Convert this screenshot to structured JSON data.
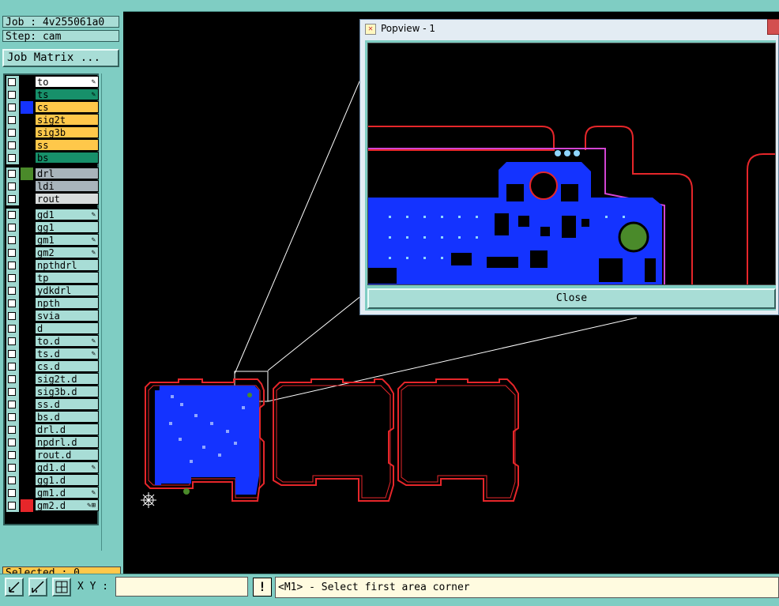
{
  "job": {
    "job_label": "Job : 4v255061a0",
    "step_label": "Step: cam",
    "matrix_button": "Job Matrix ..."
  },
  "layers": [
    {
      "name": "to",
      "bg": "#ffffff",
      "color": "#000000",
      "flag": "✎"
    },
    {
      "name": "ts",
      "bg": "#17906a",
      "color": "#000000",
      "flag": "✎"
    },
    {
      "name": "cs",
      "bg": "#ffc84a",
      "color": "#1433ff",
      "flag": ""
    },
    {
      "name": "sig2t",
      "bg": "#ffc84a",
      "color": "#000000",
      "flag": ""
    },
    {
      "name": "sig3b",
      "bg": "#ffc84a",
      "color": "#000000",
      "flag": ""
    },
    {
      "name": "ss",
      "bg": "#ffc84a",
      "color": "#000000",
      "flag": ""
    },
    {
      "name": "bs",
      "bg": "#17906a",
      "color": "#000000",
      "flag": ""
    },
    {
      "name": "drl",
      "bg": "#a8b4bb",
      "color": "#4a8a2a",
      "flag": ""
    },
    {
      "name": "ldi",
      "bg": "#a8b4bb",
      "color": "#000000",
      "flag": ""
    },
    {
      "name": "rout",
      "bg": "#d8dcdc",
      "color": "#000000",
      "flag": ""
    },
    {
      "name": "gd1",
      "bg": "#a8ddd6",
      "color": "#000000",
      "flag": "✎"
    },
    {
      "name": "gg1",
      "bg": "#a8ddd6",
      "color": "#000000",
      "flag": ""
    },
    {
      "name": "gm1",
      "bg": "#a8ddd6",
      "color": "#000000",
      "flag": "✎"
    },
    {
      "name": "gm2",
      "bg": "#a8ddd6",
      "color": "#000000",
      "flag": "✎"
    },
    {
      "name": "npthdrl",
      "bg": "#a8ddd6",
      "color": "#000000",
      "flag": ""
    },
    {
      "name": "tp",
      "bg": "#a8ddd6",
      "color": "#000000",
      "flag": ""
    },
    {
      "name": "ydkdrl",
      "bg": "#a8ddd6",
      "color": "#000000",
      "flag": ""
    },
    {
      "name": "npth",
      "bg": "#a8ddd6",
      "color": "#000000",
      "flag": ""
    },
    {
      "name": "svia",
      "bg": "#a8ddd6",
      "color": "#000000",
      "flag": ""
    },
    {
      "name": "d",
      "bg": "#a8ddd6",
      "color": "#000000",
      "flag": ""
    },
    {
      "name": "to.d",
      "bg": "#a8ddd6",
      "color": "#000000",
      "flag": "✎"
    },
    {
      "name": "ts.d",
      "bg": "#a8ddd6",
      "color": "#000000",
      "flag": "✎"
    },
    {
      "name": "cs.d",
      "bg": "#a8ddd6",
      "color": "#000000",
      "flag": ""
    },
    {
      "name": "sig2t.d",
      "bg": "#a8ddd6",
      "color": "#000000",
      "flag": ""
    },
    {
      "name": "sig3b.d",
      "bg": "#a8ddd6",
      "color": "#000000",
      "flag": ""
    },
    {
      "name": "ss.d",
      "bg": "#a8ddd6",
      "color": "#000000",
      "flag": ""
    },
    {
      "name": "bs.d",
      "bg": "#a8ddd6",
      "color": "#000000",
      "flag": ""
    },
    {
      "name": "drl.d",
      "bg": "#a8ddd6",
      "color": "#000000",
      "flag": ""
    },
    {
      "name": "npdrl.d",
      "bg": "#a8ddd6",
      "color": "#000000",
      "flag": ""
    },
    {
      "name": "rout.d",
      "bg": "#a8ddd6",
      "color": "#000000",
      "flag": ""
    },
    {
      "name": "gd1.d",
      "bg": "#a8ddd6",
      "color": "#000000",
      "flag": "✎"
    },
    {
      "name": "gg1.d",
      "bg": "#a8ddd6",
      "color": "#000000",
      "flag": ""
    },
    {
      "name": "gm1.d",
      "bg": "#a8ddd6",
      "color": "#000000",
      "flag": "✎"
    },
    {
      "name": "gm2.d",
      "bg": "#a8ddd6",
      "color": "#e6262a",
      "flag": "✎⊞"
    }
  ],
  "selected_label": "Selected : 0",
  "bottom": {
    "xy_label": "X Y :",
    "xy_value": "",
    "bang": "!",
    "status": "<M1> - Select first area corner"
  },
  "popview": {
    "title": "Popview - 1",
    "close_label": "Close"
  },
  "colors": {
    "panel": "#7fcdc3",
    "copper": "#1433ff",
    "outline": "#e6262a",
    "canvas": "#000000"
  }
}
